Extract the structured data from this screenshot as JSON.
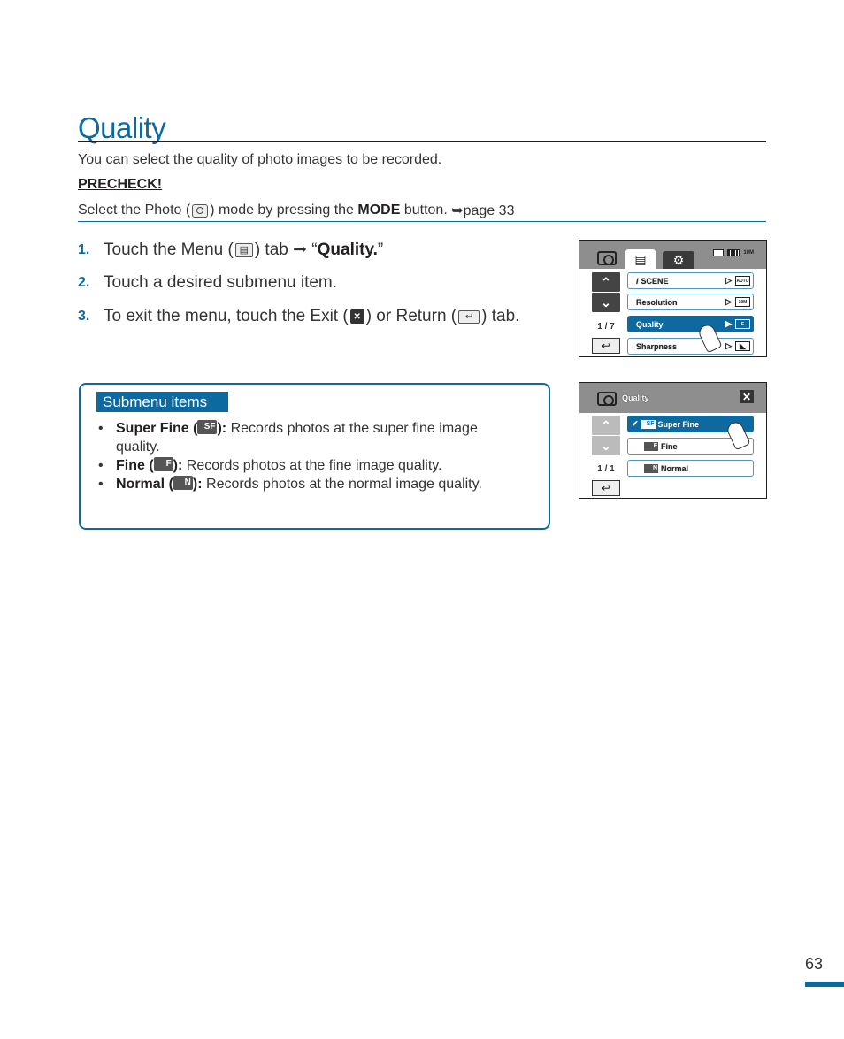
{
  "header": {
    "title": "Quality",
    "intro": "You can select the quality of photo images to be recorded."
  },
  "precheck": {
    "label": "PRECHECK!",
    "text_before": "Select the Photo (",
    "text_middle": ") mode by pressing the ",
    "mode_label": "MODE",
    "text_after": " button. ",
    "page_ref": "➥page 33"
  },
  "steps": [
    {
      "num": "1.",
      "before": "Touch the Menu (",
      "after": ") tab ➞ “",
      "bold": "Quality.",
      "end": "”"
    },
    {
      "num": "2.",
      "text": "Touch a desired submenu item."
    },
    {
      "num": "3.",
      "before": "To exit the menu, touch the Exit (",
      "middle": ") or Return (",
      "after": ") tab."
    }
  ],
  "submenu_box": {
    "heading": "Submenu items",
    "items": [
      {
        "name": "Super Fine",
        "icon_letters": "SF",
        "desc": "Records photos at the super fine image",
        "desc_cont": "quality."
      },
      {
        "name": "Fine",
        "icon_letters": "F",
        "desc": "Records photos at the fine image quality."
      },
      {
        "name": "Normal",
        "icon_letters": "N",
        "desc": "Records photos at the normal image quality."
      }
    ]
  },
  "screen1": {
    "status": {
      "card": "card",
      "battery": "battery",
      "resolution": "10M"
    },
    "page_indicator": "1 / 7",
    "items": [
      {
        "label": "SCENE",
        "prefix": "i",
        "value": "AUTO",
        "selected": false
      },
      {
        "label": "Resolution",
        "value": "10M",
        "selected": false
      },
      {
        "label": "Quality",
        "value": "F",
        "selected": true
      },
      {
        "label": "Sharpness",
        "value": "◣",
        "selected": false
      }
    ]
  },
  "screen2": {
    "title": "Quality",
    "page_indicator": "1 / 1",
    "items": [
      {
        "label": "Super Fine",
        "icon": "SF",
        "checked": true,
        "selected": true
      },
      {
        "label": "Fine",
        "icon": "F",
        "checked": false,
        "selected": false
      },
      {
        "label": "Normal",
        "icon": "N",
        "checked": false,
        "selected": false
      }
    ]
  },
  "icons": {
    "up": "⌃",
    "down": "⌄",
    "return": "↩",
    "close": "✕",
    "menu": "▤",
    "gear": "⚙",
    "play_arrow": "▷",
    "play_arrow_filled": "▶",
    "check": "✔"
  },
  "footer": {
    "page_number": "63"
  },
  "colors": {
    "accent": "#0e6a9e",
    "text": "#231f20"
  }
}
